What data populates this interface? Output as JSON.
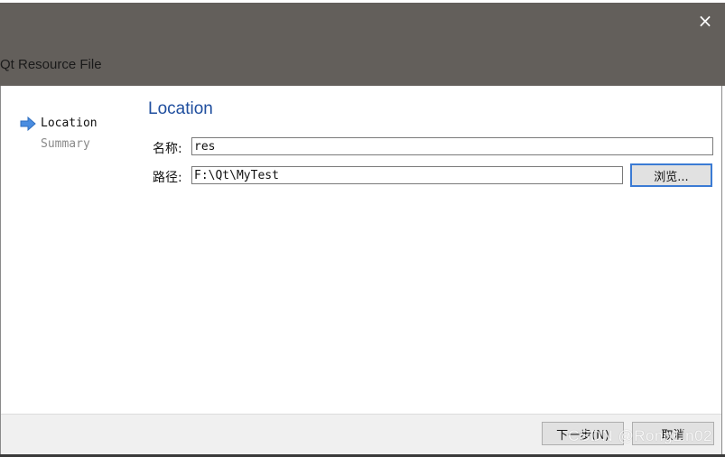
{
  "window": {
    "title": "Qt Resource File",
    "close_icon": "×"
  },
  "steps": [
    {
      "label": "Location",
      "state": "current"
    },
    {
      "label": "Summary",
      "state": "pending"
    }
  ],
  "page": {
    "title": "Location"
  },
  "form": {
    "name_label": "名称:",
    "name_value": "res",
    "path_label": "路径:",
    "path_value": "F:\\Qt\\MyTest",
    "browse_label": "浏览..."
  },
  "footer": {
    "next_label": "下一步(N)",
    "cancel_label": "取消"
  },
  "watermark": "CSDN @RongLin02",
  "colors": {
    "header_bg": "#635f5b",
    "title_blue": "#1f4e9e",
    "arrow_blue": "#4a8de0"
  }
}
